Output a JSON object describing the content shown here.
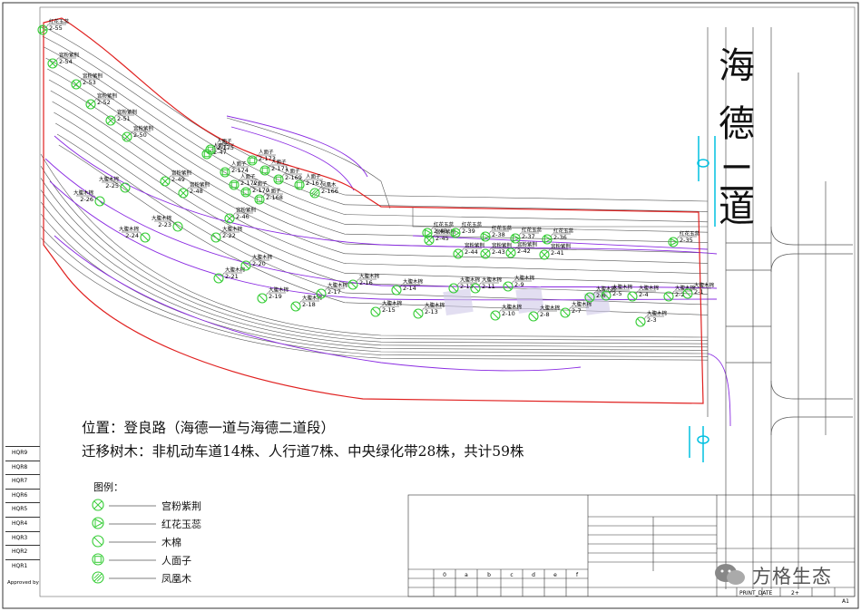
{
  "road_name": "海德二道",
  "location_text": "位置：登良路（海德一道与海德二道段）",
  "summary_text": "迁移树木：非机动车道14株、人行道7株、中央绿化带28株，共计59株",
  "legend": {
    "title": "图例：",
    "items": [
      {
        "symbol": "x-circle",
        "name": "宫粉紫荆"
      },
      {
        "symbol": "triangle-circle",
        "name": "红花玉蕊"
      },
      {
        "symbol": "slash-circle",
        "name": "木棉"
      },
      {
        "symbol": "square-circle",
        "name": "人面子"
      },
      {
        "symbol": "hatch-circle",
        "name": "凤凰木"
      }
    ]
  },
  "revisions": [
    "HQR9",
    "HQR8",
    "HQR7",
    "HQR6",
    "HQR5",
    "HQR4",
    "HQR3",
    "HQR2",
    "HQR1"
  ],
  "approved_label": "Approved by",
  "title_block": {
    "print_date": "PRINT_DATE",
    "sheet": "A1",
    "number": "2+",
    "revision_columns": [
      "0",
      "a",
      "b",
      "c",
      "d",
      "e",
      "f"
    ]
  },
  "watermark": "方格生态",
  "colors": {
    "boundary": "#e0201f",
    "lane": "#8a2be2",
    "tree": "#33cc33",
    "road_line": "#555555",
    "cyan": "#00c0e0"
  },
  "trees": [
    {
      "code": "2-55",
      "name": "红花玉蕊",
      "sym": "triangle-circle"
    },
    {
      "code": "2-54",
      "name": "宫粉紫荆",
      "sym": "x-circle"
    },
    {
      "code": "2-53",
      "name": "宫粉紫荆",
      "sym": "x-circle"
    },
    {
      "code": "2-52",
      "name": "宫粉紫荆",
      "sym": "x-circle"
    },
    {
      "code": "2-51",
      "name": "宫粉紫荆",
      "sym": "x-circle"
    },
    {
      "code": "2-50",
      "name": "宫粉紫荆",
      "sym": "x-circle"
    },
    {
      "code": "2-49",
      "name": "宫粉紫荆",
      "sym": "x-circle"
    },
    {
      "code": "2-48",
      "name": "宫粉紫荆",
      "sym": "x-circle"
    },
    {
      "code": "2-47",
      "name": "人面子",
      "sym": "square-circle"
    },
    {
      "code": "2-46",
      "name": "宫粉紫荆",
      "sym": "x-circle"
    },
    {
      "code": "2-45",
      "name": "宫粉紫荆",
      "sym": "x-circle"
    },
    {
      "code": "2-44",
      "name": "宫粉紫荆",
      "sym": "x-circle"
    },
    {
      "code": "2-43",
      "name": "宫粉紫荆",
      "sym": "x-circle"
    },
    {
      "code": "2-42",
      "name": "宫粉紫荆",
      "sym": "x-circle"
    },
    {
      "code": "2-41",
      "name": "宫粉紫荆",
      "sym": "x-circle"
    },
    {
      "code": "2-40",
      "name": "红花玉蕊",
      "sym": "triangle-circle"
    },
    {
      "code": "2-39",
      "name": "红花玉蕊",
      "sym": "triangle-circle"
    },
    {
      "code": "2-38",
      "name": "红花玉蕊",
      "sym": "triangle-circle"
    },
    {
      "code": "2-37",
      "name": "红花玉蕊",
      "sym": "triangle-circle"
    },
    {
      "code": "2-36",
      "name": "红花玉蕊",
      "sym": "triangle-circle"
    },
    {
      "code": "2-35",
      "name": "红花玉蕊",
      "sym": "triangle-circle"
    },
    {
      "code": "2-26",
      "name": "大腹木棉",
      "sym": "slash-circle"
    },
    {
      "code": "2-25",
      "name": "大腹木棉",
      "sym": "slash-circle"
    },
    {
      "code": "2-24",
      "name": "大腹木棉",
      "sym": "slash-circle"
    },
    {
      "code": "2-23",
      "name": "大腹木棉",
      "sym": "slash-circle"
    },
    {
      "code": "2-22",
      "name": "大腹木棉",
      "sym": "slash-circle"
    },
    {
      "code": "2-21",
      "name": "大腹木棉",
      "sym": "slash-circle"
    },
    {
      "code": "2-20",
      "name": "大腹木棉",
      "sym": "slash-circle"
    },
    {
      "code": "2-19",
      "name": "大腹木棉",
      "sym": "slash-circle"
    },
    {
      "code": "2-18",
      "name": "大腹木棉",
      "sym": "slash-circle"
    },
    {
      "code": "2-17",
      "name": "大腹木棉",
      "sym": "slash-circle"
    },
    {
      "code": "2-16",
      "name": "大腹木棉",
      "sym": "slash-circle"
    },
    {
      "code": "2-15",
      "name": "大腹木棉",
      "sym": "slash-circle"
    },
    {
      "code": "2-14",
      "name": "大腹木棉",
      "sym": "slash-circle"
    },
    {
      "code": "2-13",
      "name": "大腹木棉",
      "sym": "slash-circle"
    },
    {
      "code": "2-12",
      "name": "大腹木棉",
      "sym": "slash-circle"
    },
    {
      "code": "2-11",
      "name": "大腹木棉",
      "sym": "slash-circle"
    },
    {
      "code": "2-10",
      "name": "大腹木棉",
      "sym": "slash-circle"
    },
    {
      "code": "2-9",
      "name": "大腹木棉",
      "sym": "slash-circle"
    },
    {
      "code": "2-8",
      "name": "大腹木棉",
      "sym": "slash-circle"
    },
    {
      "code": "2-7",
      "name": "大腹木棉",
      "sym": "slash-circle"
    },
    {
      "code": "2-6",
      "name": "大腹木棉",
      "sym": "slash-circle"
    },
    {
      "code": "2-5",
      "name": "大腹木棉",
      "sym": "slash-circle"
    },
    {
      "code": "2-4",
      "name": "大腹木棉",
      "sym": "slash-circle"
    },
    {
      "code": "2-3",
      "name": "大腹木棉",
      "sym": "slash-circle"
    },
    {
      "code": "2-2",
      "name": "大腹木棉",
      "sym": "slash-circle"
    },
    {
      "code": "2-1",
      "name": "大腹木棉",
      "sym": "slash-circle"
    },
    {
      "code": "2-175",
      "name": "人面子",
      "sym": "square-circle"
    },
    {
      "code": "2-174",
      "name": "人面子",
      "sym": "square-circle"
    },
    {
      "code": "2-173",
      "name": "人面子",
      "sym": "square-circle"
    },
    {
      "code": "2-172",
      "name": "人面子",
      "sym": "square-circle"
    },
    {
      "code": "2-171",
      "name": "人面子",
      "sym": "square-circle"
    },
    {
      "code": "2-170",
      "name": "人面子",
      "sym": "square-circle"
    },
    {
      "code": "2-169",
      "name": "人面子",
      "sym": "square-circle"
    },
    {
      "code": "2-168",
      "name": "人面子",
      "sym": "square-circle"
    },
    {
      "code": "2-167",
      "name": "人面子",
      "sym": "square-circle"
    },
    {
      "code": "2-166",
      "name": "凤凰木",
      "sym": "hatch-circle"
    }
  ]
}
